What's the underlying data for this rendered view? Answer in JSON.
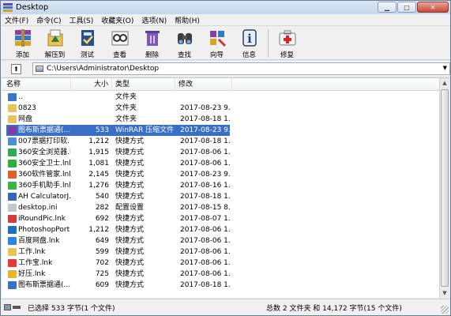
{
  "window": {
    "title": "Desktop"
  },
  "menu": [
    "文件(F)",
    "命令(C)",
    "工具(S)",
    "收藏夹(O)",
    "选项(N)",
    "帮助(H)"
  ],
  "toolbar": [
    {
      "label": "添加",
      "icon": "add-archive-icon"
    },
    {
      "label": "解压到",
      "icon": "extract-to-icon"
    },
    {
      "label": "测试",
      "icon": "test-icon"
    },
    {
      "label": "查看",
      "icon": "view-icon"
    },
    {
      "label": "删除",
      "icon": "delete-icon"
    },
    {
      "label": "查找",
      "icon": "find-icon"
    },
    {
      "label": "向导",
      "icon": "wizard-icon"
    },
    {
      "label": "信息",
      "icon": "info-icon"
    },
    {
      "label": "修复",
      "icon": "repair-icon"
    }
  ],
  "address": {
    "path": "C:\\Users\\Administrator\\Desktop"
  },
  "columns": {
    "name": "名称",
    "size": "大小",
    "type": "类型",
    "date": "修改"
  },
  "files": [
    {
      "name": "..",
      "size": "",
      "type": "文件夹",
      "date": "",
      "icon": "parent-folder-icon",
      "selected": false
    },
    {
      "name": "0823",
      "size": "",
      "type": "文件夹",
      "date": "2017-08-23 9...",
      "icon": "folder-icon",
      "selected": false
    },
    {
      "name": "网盘",
      "size": "",
      "type": "文件夹",
      "date": "2017-08-18 1...",
      "icon": "folder-icon",
      "selected": false
    },
    {
      "name": "图布斯票据通(...",
      "size": "533",
      "type": "WinRAR 压缩文件",
      "date": "2017-08-23 9...",
      "icon": "rar-icon",
      "selected": true
    },
    {
      "name": "007票据打印软...",
      "size": "1,212",
      "type": "快捷方式",
      "date": "2017-08-18 1...",
      "icon": "shortcut-icon",
      "selected": false
    },
    {
      "name": "360安全浏览器.l...",
      "size": "1,915",
      "type": "快捷方式",
      "date": "2017-08-06 1...",
      "icon": "browser-icon",
      "selected": false
    },
    {
      "name": "360安全卫士.lnk",
      "size": "1,081",
      "type": "快捷方式",
      "date": "2017-08-06 1...",
      "icon": "guard-icon",
      "selected": false
    },
    {
      "name": "360软件管家.lnk",
      "size": "2,145",
      "type": "快捷方式",
      "date": "2017-08-23 9...",
      "icon": "software-icon",
      "selected": false
    },
    {
      "name": "360手机助手.lnk",
      "size": "1,276",
      "type": "快捷方式",
      "date": "2017-08-16 1...",
      "icon": "phone-icon",
      "selected": false
    },
    {
      "name": "AH CalculatorJ...",
      "size": "540",
      "type": "快捷方式",
      "date": "2017-08-18 1...",
      "icon": "calculator-icon",
      "selected": false
    },
    {
      "name": "desktop.ini",
      "size": "282",
      "type": "配置设置",
      "date": "2017-08-15 8...",
      "icon": "ini-file-icon",
      "selected": false
    },
    {
      "name": "iRoundPic.lnk",
      "size": "692",
      "type": "快捷方式",
      "date": "2017-08-07 1...",
      "icon": "app-icon",
      "selected": false
    },
    {
      "name": "PhotoshopPort...",
      "size": "1,212",
      "type": "快捷方式",
      "date": "2017-08-06 1...",
      "icon": "photoshop-icon",
      "selected": false
    },
    {
      "name": "百度网盘.lnk",
      "size": "649",
      "type": "快捷方式",
      "date": "2017-08-06 1...",
      "icon": "cloud-icon",
      "selected": false
    },
    {
      "name": "工作.lnk",
      "size": "599",
      "type": "快捷方式",
      "date": "2017-08-06 1...",
      "icon": "folder-shortcut-icon",
      "selected": false
    },
    {
      "name": "工作宝.lnk",
      "size": "702",
      "type": "快捷方式",
      "date": "2017-08-06 1...",
      "icon": "work-icon",
      "selected": false
    },
    {
      "name": "好压.lnk",
      "size": "725",
      "type": "快捷方式",
      "date": "2017-08-06 1...",
      "icon": "haozip-icon",
      "selected": false
    },
    {
      "name": "图布斯票据通(...",
      "size": "609",
      "type": "快捷方式",
      "date": "2017-08-18 1...",
      "icon": "app-shortcut-icon",
      "selected": false
    }
  ],
  "status": {
    "left": "已选择 533 字节(1 个文件)",
    "right": "总数 2 文件夹 和 14,172 字节(15 个文件)"
  },
  "colors": {
    "selection": "#3a6fc6",
    "folder": "#e8c25a"
  }
}
